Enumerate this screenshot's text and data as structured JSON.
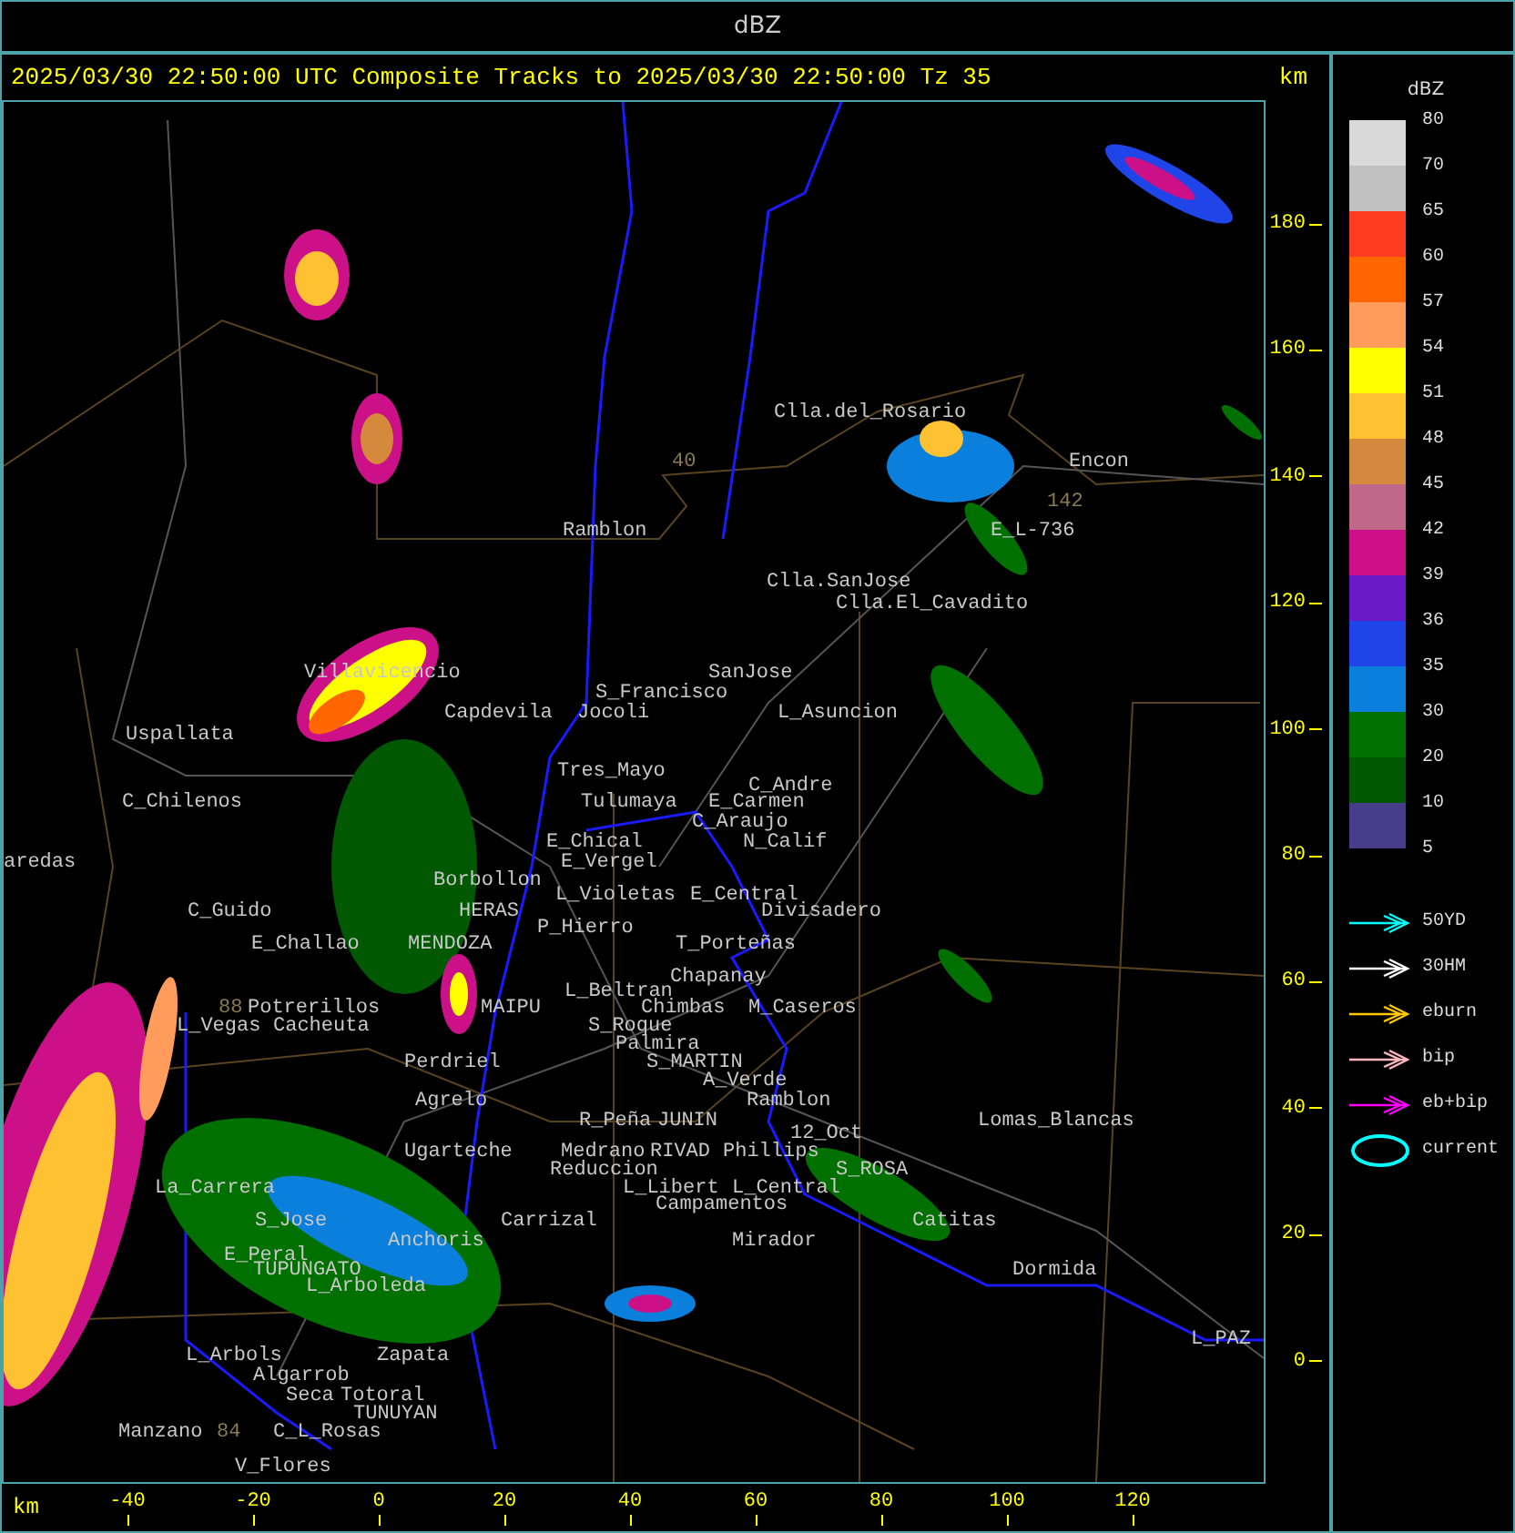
{
  "window": {
    "title": "dBZ"
  },
  "header": {
    "text": "2025/03/30 22:50:00 UTC Composite Tracks to 2025/03/30 22:50:00 Tz 35",
    "unit": "km"
  },
  "map": {
    "places": [
      {
        "name": "Clla.del_Rosario",
        "kind": "town"
      },
      {
        "name": "40",
        "kind": "route"
      },
      {
        "name": "Encon",
        "kind": "town"
      },
      {
        "name": "142",
        "kind": "route"
      },
      {
        "name": "Ramblon",
        "kind": "town"
      },
      {
        "name": "E_L-736",
        "kind": "town"
      },
      {
        "name": "Clla.SanJose",
        "kind": "town"
      },
      {
        "name": "Clla.El_Cavadito",
        "kind": "town"
      },
      {
        "name": "Villavicencio",
        "kind": "town"
      },
      {
        "name": "SanJose",
        "kind": "town"
      },
      {
        "name": "S_Francisco",
        "kind": "town"
      },
      {
        "name": "Capdevila",
        "kind": "town"
      },
      {
        "name": "Jocoli",
        "kind": "town"
      },
      {
        "name": "L_Asuncion",
        "kind": "town"
      },
      {
        "name": "Uspallata",
        "kind": "town"
      },
      {
        "name": "Tres_Mayo",
        "kind": "town"
      },
      {
        "name": "C_Andre",
        "kind": "town"
      },
      {
        "name": "C_Chilenos",
        "kind": "town"
      },
      {
        "name": "Tulumaya",
        "kind": "town"
      },
      {
        "name": "E_Carmen",
        "kind": "town"
      },
      {
        "name": "C_Araujo",
        "kind": "town"
      },
      {
        "name": "E_Chical",
        "kind": "town"
      },
      {
        "name": "N_Calif",
        "kind": "town"
      },
      {
        "name": "aredas",
        "kind": "town"
      },
      {
        "name": "E_Vergel",
        "kind": "town"
      },
      {
        "name": "Borbollon",
        "kind": "town"
      },
      {
        "name": "L_Violetas",
        "kind": "town"
      },
      {
        "name": "E_Central",
        "kind": "town"
      },
      {
        "name": "C_Guido",
        "kind": "town"
      },
      {
        "name": "HERAS",
        "kind": "town"
      },
      {
        "name": "Divisadero",
        "kind": "town"
      },
      {
        "name": "P_Hierro",
        "kind": "town"
      },
      {
        "name": "E_Challao",
        "kind": "town"
      },
      {
        "name": "MENDOZA",
        "kind": "town"
      },
      {
        "name": "T_Porteñas",
        "kind": "town"
      },
      {
        "name": "Chapanay",
        "kind": "town"
      },
      {
        "name": "L_Beltran",
        "kind": "town"
      },
      {
        "name": "88",
        "kind": "route"
      },
      {
        "name": "Potrerillos",
        "kind": "town"
      },
      {
        "name": "MAIPU",
        "kind": "town"
      },
      {
        "name": "Chimbas",
        "kind": "town"
      },
      {
        "name": "M_Caseros",
        "kind": "town"
      },
      {
        "name": "L_Vegas",
        "kind": "town"
      },
      {
        "name": "Cacheuta",
        "kind": "town"
      },
      {
        "name": "S_Roque",
        "kind": "town"
      },
      {
        "name": "Palmira",
        "kind": "town"
      },
      {
        "name": "Perdriel",
        "kind": "town"
      },
      {
        "name": "S_MARTIN",
        "kind": "town"
      },
      {
        "name": "A_Verde",
        "kind": "town"
      },
      {
        "name": "Agrelo",
        "kind": "town"
      },
      {
        "name": "Ramblon",
        "kind": "town"
      },
      {
        "name": "R_Peña",
        "kind": "town"
      },
      {
        "name": "JUNIN",
        "kind": "town"
      },
      {
        "name": "Lomas_Blancas",
        "kind": "town"
      },
      {
        "name": "12_Oct",
        "kind": "town"
      },
      {
        "name": "Ugarteche",
        "kind": "town"
      },
      {
        "name": "Medrano",
        "kind": "town"
      },
      {
        "name": "RIVAD",
        "kind": "town"
      },
      {
        "name": "Phillips",
        "kind": "town"
      },
      {
        "name": "Reduccion",
        "kind": "town"
      },
      {
        "name": "S_ROSA",
        "kind": "town"
      },
      {
        "name": "La_Carrera",
        "kind": "town"
      },
      {
        "name": "L_Libert",
        "kind": "town"
      },
      {
        "name": "L_Central",
        "kind": "town"
      },
      {
        "name": "Campamentos",
        "kind": "town"
      },
      {
        "name": "S_Jose",
        "kind": "town"
      },
      {
        "name": "Carrizal",
        "kind": "town"
      },
      {
        "name": "Catitas",
        "kind": "town"
      },
      {
        "name": "Anchoris",
        "kind": "town"
      },
      {
        "name": "Mirador",
        "kind": "town"
      },
      {
        "name": "E_Peral",
        "kind": "town"
      },
      {
        "name": "TUPUNGATO",
        "kind": "town"
      },
      {
        "name": "Dormida",
        "kind": "town"
      },
      {
        "name": "L_Arboleda",
        "kind": "town"
      },
      {
        "name": "L_PAZ",
        "kind": "town"
      },
      {
        "name": "L_Arbols",
        "kind": "town"
      },
      {
        "name": "Zapata",
        "kind": "town"
      },
      {
        "name": "Algarrob",
        "kind": "town"
      },
      {
        "name": "Seca",
        "kind": "town"
      },
      {
        "name": "Totoral",
        "kind": "town"
      },
      {
        "name": "TUNUYAN",
        "kind": "town"
      },
      {
        "name": "Manzano",
        "kind": "town"
      },
      {
        "name": "84",
        "kind": "route"
      },
      {
        "name": "C_L_Rosas",
        "kind": "town"
      },
      {
        "name": "V_Flores",
        "kind": "town"
      }
    ]
  },
  "y_axis": {
    "ticks": [
      "180",
      "160",
      "140",
      "120",
      "100",
      "80",
      "60",
      "40",
      "20",
      "0"
    ]
  },
  "x_axis": {
    "unit": "km",
    "ticks": [
      "-40",
      "-20",
      "0",
      "20",
      "40",
      "60",
      "80",
      "100",
      "120"
    ]
  },
  "legend": {
    "title": "dBZ",
    "bottom_label": "5",
    "bands": [
      {
        "label": "80",
        "color": "#d9d9d9"
      },
      {
        "label": "70",
        "color": "#c0c0c0"
      },
      {
        "label": "65",
        "color": "#ff3b1f"
      },
      {
        "label": "60",
        "color": "#ff6600"
      },
      {
        "label": "57",
        "color": "#ff9b5b"
      },
      {
        "label": "54",
        "color": "#ffff00"
      },
      {
        "label": "51",
        "color": "#fec132"
      },
      {
        "label": "48",
        "color": "#d4893c"
      },
      {
        "label": "45",
        "color": "#c0688a"
      },
      {
        "label": "42",
        "color": "#cc1188"
      },
      {
        "label": "39",
        "color": "#6b1ac8"
      },
      {
        "label": "36",
        "color": "#1f44e8"
      },
      {
        "label": "35",
        "color": "#0a80dc"
      },
      {
        "label": "30",
        "color": "#007000"
      },
      {
        "label": "20",
        "color": "#005800"
      },
      {
        "label": "10",
        "color": "#483d8b"
      }
    ],
    "tracks": [
      {
        "label": "50YD",
        "kind": "arrow",
        "color": "#00ffff"
      },
      {
        "label": "30HM",
        "kind": "arrow",
        "color": "#ffffff"
      },
      {
        "label": "eburn",
        "kind": "arrow",
        "color": "#ffc800"
      },
      {
        "label": "bip",
        "kind": "arrow",
        "color": "#ffb6c1"
      },
      {
        "label": "eb+bip",
        "kind": "arrow",
        "color": "#ff00ff"
      },
      {
        "label": "current",
        "kind": "ellipse",
        "color": "#00ffff"
      }
    ]
  }
}
